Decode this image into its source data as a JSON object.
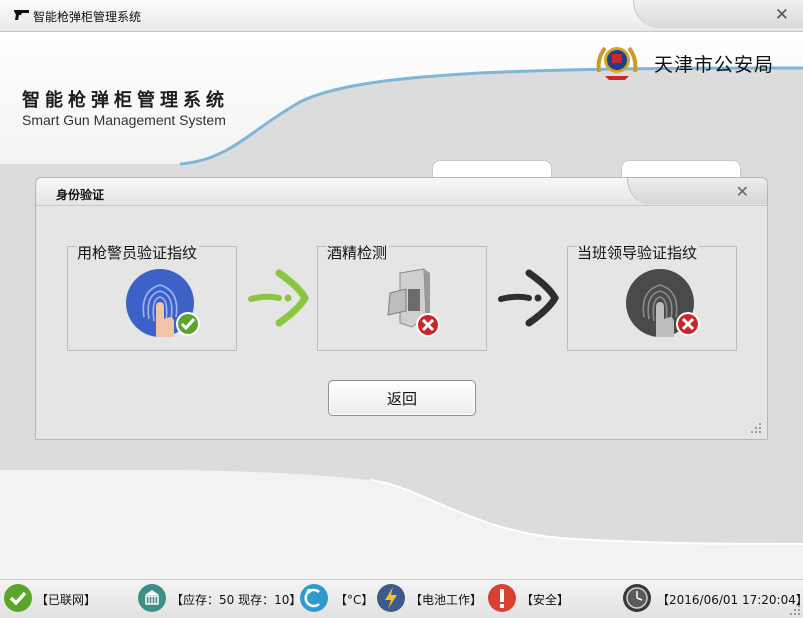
{
  "window": {
    "title": "智能枪弹柜管理系统",
    "close_glyph": "✕"
  },
  "header": {
    "app_name_cn": "智能枪弹柜管理系统",
    "app_name_en": "Smart Gun Management System",
    "police_bureau": "天津市公安局"
  },
  "dialog": {
    "title": "身份验证",
    "close_glyph": "✕",
    "steps": [
      {
        "label": "用枪警员验证指纹",
        "icon": "fingerprint-icon",
        "status": "success"
      },
      {
        "label": "酒精检测",
        "icon": "alcohol-tester-icon",
        "status": "fail"
      },
      {
        "label": "当班领导验证指纹",
        "icon": "fingerprint-icon",
        "status": "fail"
      }
    ],
    "back_button": "返回"
  },
  "statusbar": {
    "network": "【已联网】",
    "stock": "【应存：50 现存：10】",
    "temperature": "【°C】",
    "power": "【电池工作】",
    "safety": "【安全】",
    "datetime": "【2016/06/01 17:20:04】"
  },
  "colors": {
    "success": "#5aa52b",
    "fail": "#c8282b",
    "fingerprint_active": "#3d62c7",
    "fingerprint_inactive": "#4a4a4a",
    "accent_blue": "#6ba5c8",
    "arrow_green": "#8ac640",
    "arrow_dark": "#2e2e2e"
  }
}
